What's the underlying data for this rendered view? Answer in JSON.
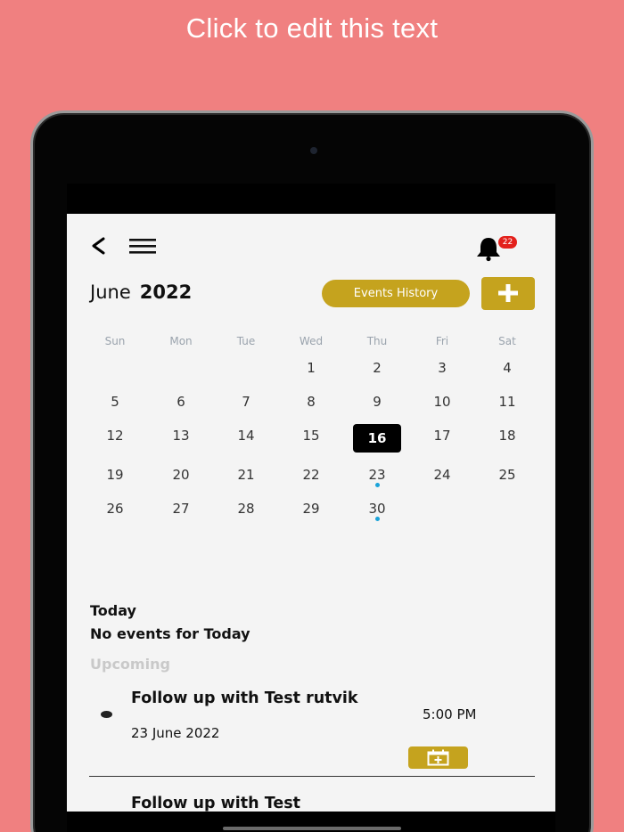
{
  "promo": {
    "text": "Click to edit this text"
  },
  "header": {
    "icons": [
      "back-icon",
      "menu-icon",
      "bell-icon"
    ],
    "notification_count": "22"
  },
  "calendar": {
    "month": "June",
    "year": "2022",
    "events_history_label": "Events History",
    "weekdays": [
      "Sun",
      "Mon",
      "Tue",
      "Wed",
      "Thu",
      "Fri",
      "Sat"
    ],
    "days": [
      "1",
      "2",
      "3",
      "4",
      "5",
      "6",
      "7",
      "8",
      "9",
      "10",
      "11",
      "12",
      "13",
      "14",
      "15",
      "16",
      "17",
      "18",
      "19",
      "20",
      "21",
      "22",
      "23",
      "24",
      "25",
      "26",
      "27",
      "28",
      "29",
      "30"
    ],
    "selected_day": "16",
    "days_with_events": [
      "23",
      "30"
    ]
  },
  "today": {
    "label": "Today",
    "empty_message": "No events for Today"
  },
  "upcoming": {
    "label": "Upcoming",
    "events": [
      {
        "title": "Follow up with Test rutvik",
        "date": "23 June 2022",
        "time": "5:00 PM"
      },
      {
        "title": "Follow up with Test"
      }
    ]
  },
  "colors": {
    "background": "#f08080",
    "accent": "#c5a31e",
    "badge": "#e3201b",
    "event_dot": "#1aa3d9"
  }
}
